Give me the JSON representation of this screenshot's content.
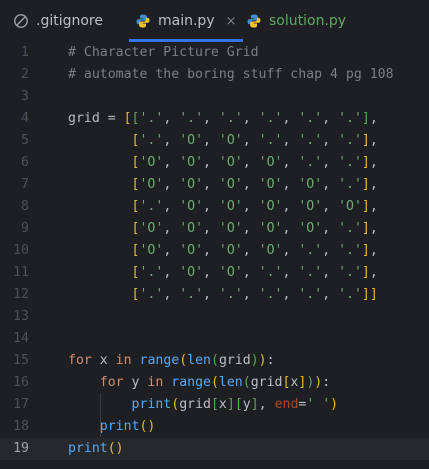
{
  "tabs": [
    {
      "label": ".gitignore",
      "icon": "gitignore-icon",
      "active": false
    },
    {
      "label": "main.py",
      "icon": "python-icon",
      "active": true,
      "close": "×"
    },
    {
      "label": "solution.py",
      "icon": "python-icon",
      "active": false
    }
  ],
  "editor": {
    "current_line": 19,
    "lines": [
      {
        "n": "1",
        "text": "# Character Picture Grid"
      },
      {
        "n": "2",
        "text": "# automate the boring stuff chap 4 pg 108"
      },
      {
        "n": "3",
        "text": ""
      },
      {
        "n": "4",
        "text": "grid = [['.', '.', '.', '.', '.', '.'],"
      },
      {
        "n": "5",
        "text": "        ['.', 'O', 'O', '.', '.', '.'],"
      },
      {
        "n": "6",
        "text": "        ['O', 'O', 'O', 'O', '.', '.'],"
      },
      {
        "n": "7",
        "text": "        ['O', 'O', 'O', 'O', 'O', '.'],"
      },
      {
        "n": "8",
        "text": "        ['.', 'O', 'O', 'O', 'O', 'O'],"
      },
      {
        "n": "9",
        "text": "        ['O', 'O', 'O', 'O', 'O', '.'],"
      },
      {
        "n": "10",
        "text": "        ['O', 'O', 'O', 'O', '.', '.'],"
      },
      {
        "n": "11",
        "text": "        ['.', 'O', 'O', '.', '.', '.'],"
      },
      {
        "n": "12",
        "text": "        ['.', '.', '.', '.', '.', '.']]"
      },
      {
        "n": "13",
        "text": ""
      },
      {
        "n": "14",
        "text": ""
      },
      {
        "n": "15",
        "text": "for x in range(len(grid)):"
      },
      {
        "n": "16",
        "text": "    for y in range(len(grid[x])):"
      },
      {
        "n": "17",
        "text": "        print(grid[x][y], end=' ')"
      },
      {
        "n": "18",
        "text": "    print()"
      },
      {
        "n": "19",
        "text": "print()"
      }
    ]
  },
  "colors": {
    "background": "#1e1f22",
    "keyword": "#cf8e6d",
    "string": "#6aab73",
    "comment": "#7a7e85",
    "function": "#56a8f5",
    "active_tab_underline": "#3574f0"
  }
}
